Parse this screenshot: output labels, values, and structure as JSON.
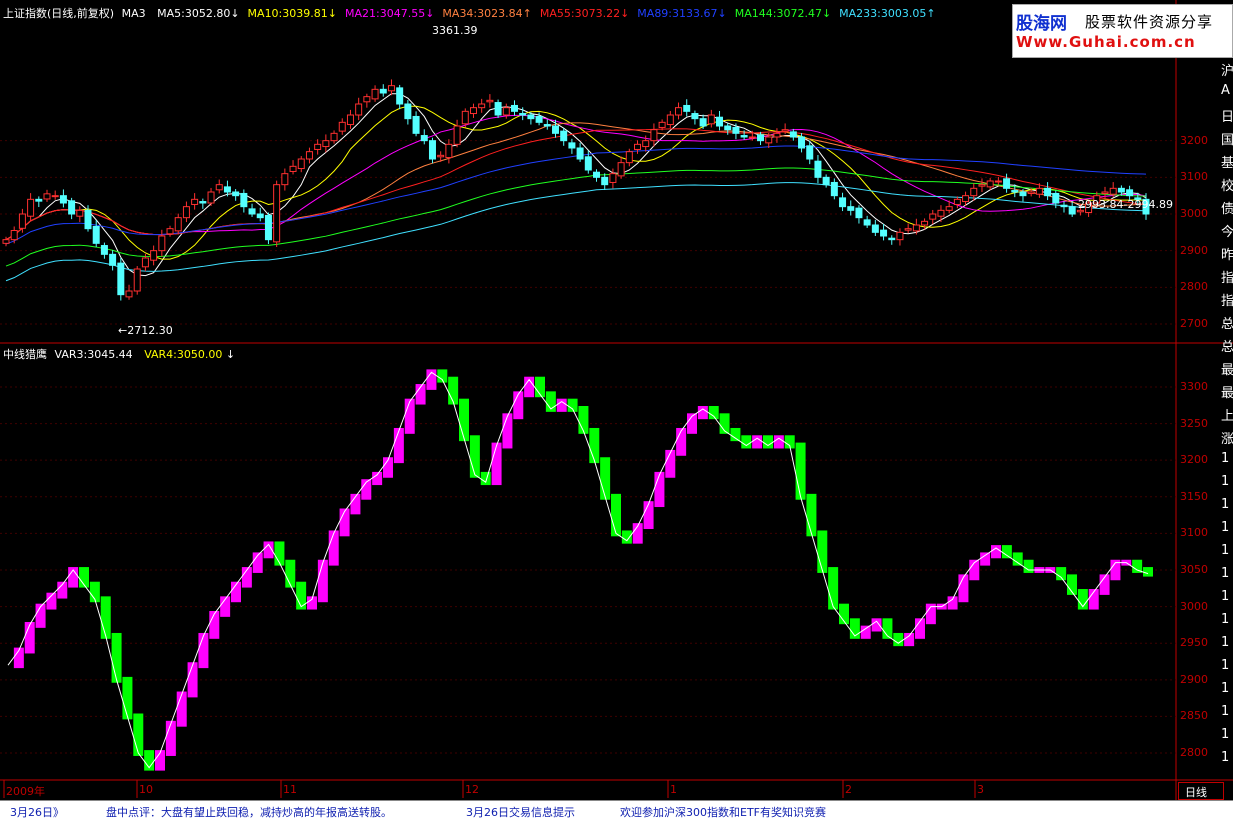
{
  "top_header": {
    "name": "上证指数(日线,前复权)",
    "ma3": "MA3",
    "items": [
      {
        "label": "MA5:3052.80",
        "arrow": "↓",
        "color": "#ffffff"
      },
      {
        "label": "MA10:3039.81",
        "arrow": "↓",
        "color": "#ffff00"
      },
      {
        "label": "MA21:3047.55",
        "arrow": "↓",
        "color": "#ff00ff"
      },
      {
        "label": "MA34:3023.84",
        "arrow": "↑",
        "color": "#ff8040"
      },
      {
        "label": "MA55:3073.22",
        "arrow": "↓",
        "color": "#ff2020"
      },
      {
        "label": "MA89:3133.67",
        "arrow": "↓",
        "color": "#2040ff"
      },
      {
        "label": "MA144:3072.47",
        "arrow": "↓",
        "color": "#20ff20"
      },
      {
        "label": "MA233:3003.05",
        "arrow": "↑",
        "color": "#40e0ff"
      }
    ]
  },
  "bottom_header": {
    "name": "中线猎鹰",
    "var3": "VAR3:3045.44",
    "var4": "VAR4:3050.00",
    "var4_arrow": "↓"
  },
  "logo": {
    "cn": "股海网",
    "slogan": "股票软件资源分享",
    "url": "Www.Guhai.com.cn"
  },
  "annotations": {
    "high": "3361.39",
    "low": "←2712.30",
    "range": "2993.84-2994.89"
  },
  "top_axis": [
    "3200",
    "3100",
    "3000",
    "2900",
    "2800",
    "2700"
  ],
  "bottom_axis": [
    "3300",
    "3250",
    "3200",
    "3150",
    "3100",
    "3050",
    "3000",
    "2950",
    "2900",
    "2850",
    "2800"
  ],
  "x_axis": [
    "2009年",
    "10",
    "11",
    "12",
    "1",
    "2",
    "3"
  ],
  "period_button": "日线",
  "right_sidebar": [
    "沪",
    "A",
    "日",
    "国",
    "基",
    "校",
    "债",
    "今",
    "昨",
    "指",
    "指",
    "总",
    "总",
    "最",
    "最",
    "上",
    "涨",
    "1",
    "1",
    "1",
    "1",
    "1",
    "1",
    "1",
    "1",
    "1",
    "1",
    "1",
    "1",
    "1",
    "1"
  ],
  "status_bar": {
    "date": "3月26日》",
    "comment": "盘中点评：大盘有望止跌回稳，减持炒高的年报高送转股。",
    "tips": "3月26日交易信息提示",
    "welcome": "欢迎参加沪深300指数和ETF有奖知识竞赛"
  },
  "colors": {
    "up": "#ff3030",
    "down": "#54ffff",
    "axis": "#c00000",
    "var_up": "#ff00ff",
    "var_down": "#00ff00"
  },
  "chart_data": [
    {
      "type": "candlestick",
      "title": "上证指数(日线,前复权)",
      "ylim": [
        2670,
        3420
      ],
      "close": [
        2930,
        2955,
        3000,
        3040,
        3035,
        3055,
        3050,
        3030,
        3000,
        3010,
        2960,
        2920,
        2890,
        2860,
        2780,
        2790,
        2850,
        2880,
        2900,
        2940,
        2960,
        2990,
        3020,
        3040,
        3030,
        3060,
        3080,
        3060,
        3050,
        3020,
        3000,
        2990,
        2930,
        3080,
        3110,
        3130,
        3150,
        3170,
        3190,
        3200,
        3220,
        3250,
        3270,
        3300,
        3320,
        3340,
        3330,
        3350,
        3300,
        3260,
        3220,
        3200,
        3150,
        3160,
        3190,
        3240,
        3280,
        3290,
        3300,
        3310,
        3270,
        3290,
        3280,
        3270,
        3260,
        3250,
        3240,
        3220,
        3200,
        3180,
        3150,
        3120,
        3100,
        3080,
        3110,
        3140,
        3170,
        3190,
        3200,
        3230,
        3250,
        3270,
        3290,
        3280,
        3260,
        3240,
        3270,
        3240,
        3230,
        3220,
        3210,
        3210,
        3200,
        3210,
        3220,
        3230,
        3210,
        3180,
        3150,
        3100,
        3080,
        3050,
        3020,
        3010,
        2990,
        2970,
        2950,
        2940,
        2930,
        2950,
        2960,
        2970,
        2980,
        3000,
        3010,
        3020,
        3040,
        3050,
        3070,
        3080,
        3090,
        3090,
        3070,
        3060,
        3050,
        3060,
        3070,
        3050,
        3030,
        3020,
        3000,
        3010,
        3030,
        3050,
        3060,
        3070,
        3060,
        3050,
        3040,
        3000
      ]
    },
    {
      "type": "line",
      "title": "中线猎鹰",
      "ylim": [
        2770,
        3330
      ],
      "series": [
        {
          "name": "VAR3",
          "values": [
            2920,
            2940,
            2975,
            3000,
            3015,
            3030,
            3050,
            3030,
            3010,
            2960,
            2900,
            2850,
            2800,
            2780,
            2800,
            2840,
            2880,
            2920,
            2960,
            2990,
            3010,
            3030,
            3050,
            3070,
            3085,
            3060,
            3030,
            3000,
            3010,
            3060,
            3100,
            3130,
            3150,
            3170,
            3180,
            3200,
            3240,
            3280,
            3300,
            3320,
            3310,
            3280,
            3230,
            3180,
            3170,
            3220,
            3260,
            3290,
            3310,
            3290,
            3270,
            3280,
            3270,
            3240,
            3200,
            3150,
            3100,
            3090,
            3110,
            3140,
            3180,
            3210,
            3240,
            3260,
            3270,
            3260,
            3240,
            3230,
            3220,
            3230,
            3220,
            3230,
            3220,
            3150,
            3100,
            3050,
            3000,
            2980,
            2960,
            2970,
            2980,
            2960,
            2950,
            2960,
            2980,
            3000,
            3000,
            3010,
            3040,
            3060,
            3070,
            3080,
            3070,
            3060,
            3050,
            3050,
            3050,
            3040,
            3020,
            3000,
            3020,
            3040,
            3060,
            3060,
            3050,
            3045
          ]
        }
      ]
    }
  ]
}
